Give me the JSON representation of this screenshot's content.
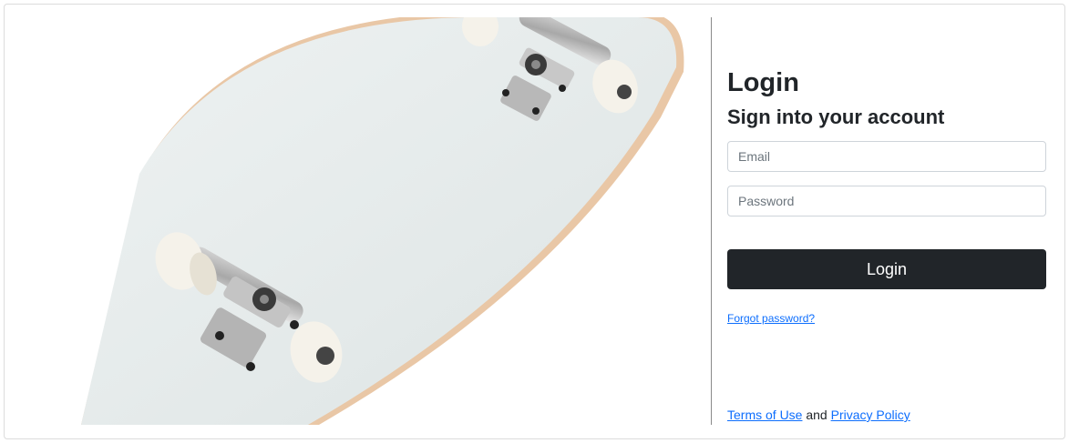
{
  "login": {
    "title": "Login",
    "subtitle": "Sign into your account",
    "email_placeholder": "Email",
    "password_placeholder": "Password",
    "button_label": "Login",
    "forgot_link": "Forgot password?"
  },
  "footer": {
    "terms_link": "Terms of Use",
    "conjunction": "and",
    "privacy_link": "Privacy Policy"
  },
  "colors": {
    "button_bg": "#212529",
    "link": "#0d6efd",
    "deck": "#e6ebeb"
  }
}
